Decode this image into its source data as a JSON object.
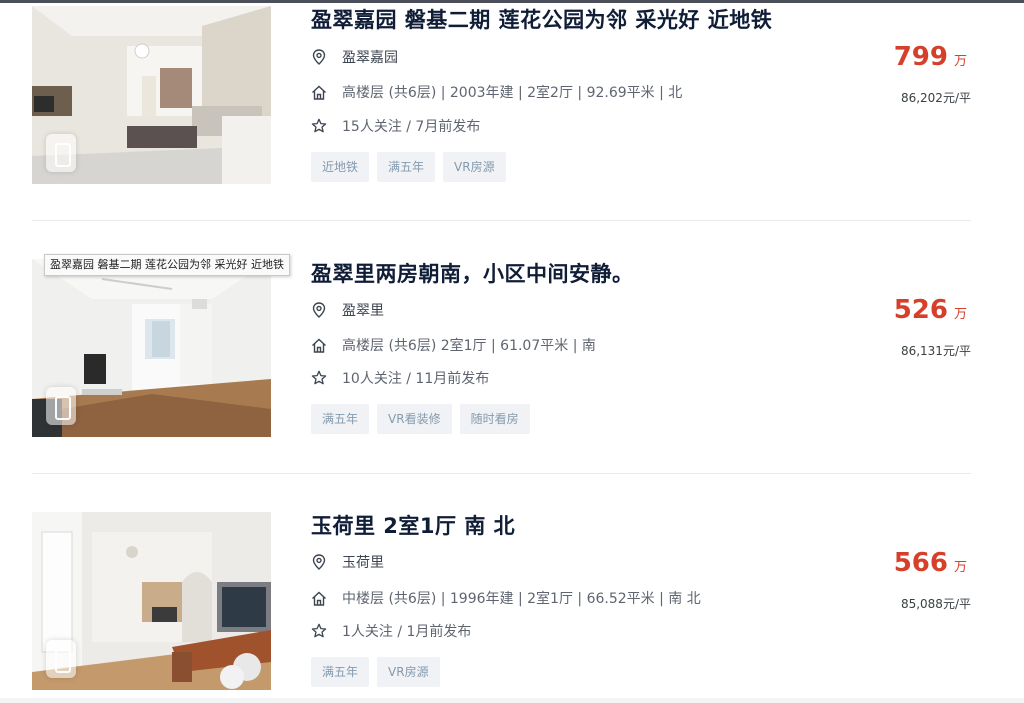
{
  "listings": [
    {
      "title": "盈翠嘉园 磐基二期 莲花公园为邻 采光好 近地铁",
      "community": "盈翠嘉园",
      "info": "高楼层 (共6层) | 2003年建 | 2室2厅 | 92.69平米 | 北",
      "follow": "15人关注 / 7月前发布",
      "tags": [
        "近地铁",
        "满五年",
        "VR房源"
      ],
      "price": "799",
      "price_unit": "万",
      "unit_price": "86,202元/平"
    },
    {
      "title": "盈翠里两房朝南，小区中间安静。",
      "community": "盈翠里",
      "info": "高楼层 (共6层) 2室1厅 | 61.07平米 | 南",
      "follow": "10人关注 / 11月前发布",
      "tags": [
        "满五年",
        "VR看装修",
        "随时看房"
      ],
      "price": "526",
      "price_unit": "万",
      "unit_price": "86,131元/平"
    },
    {
      "title": "玉荷里 2室1厅 南 北",
      "community": "玉荷里",
      "info": "中楼层 (共6层) | 1996年建 | 2室1厅 | 66.52平米 | 南 北",
      "follow": "1人关注 / 1月前发布",
      "tags": [
        "满五年",
        "VR房源"
      ],
      "price": "566",
      "price_unit": "万",
      "unit_price": "85,088元/平"
    }
  ],
  "tooltip": "盈翠嘉园  磐基二期  莲花公园为邻   采光好   近地铁",
  "icons": {
    "location": "location-pin-icon",
    "house": "house-icon",
    "follow": "star-icon"
  },
  "colors": {
    "price": "#d6402b",
    "tag_bg": "#f0f2f5",
    "tag_text": "#849aae",
    "title": "#101d37"
  }
}
